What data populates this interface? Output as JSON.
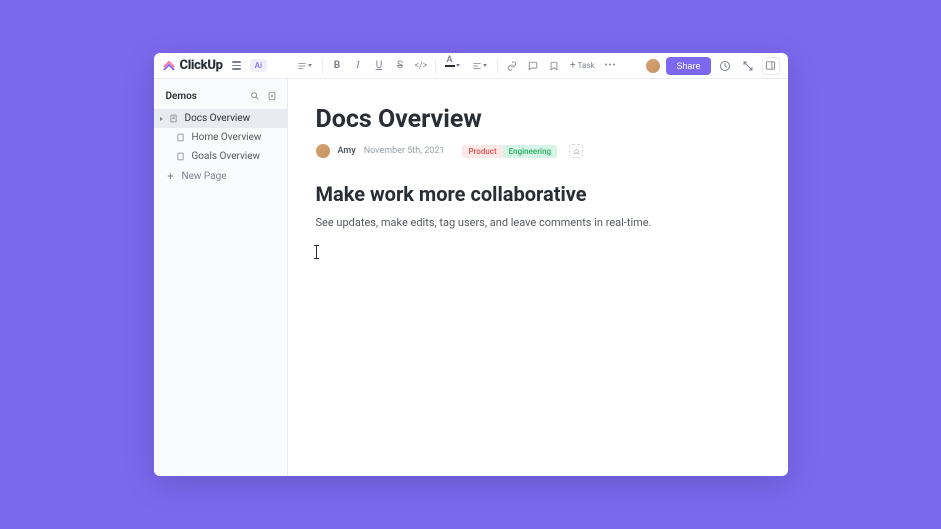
{
  "brand": {
    "name": "ClickUp",
    "ai_badge": "Ai"
  },
  "topbar": {
    "task_label": "Task",
    "share_label": "Share"
  },
  "sidebar": {
    "title": "Demos",
    "items": [
      {
        "label": "Docs Overview",
        "active": true,
        "icon": "doc"
      },
      {
        "label": "Home Overview",
        "active": false,
        "icon": "page"
      },
      {
        "label": "Goals Overview",
        "active": false,
        "icon": "page"
      }
    ],
    "new_page_label": "New Page"
  },
  "document": {
    "title": "Docs Overview",
    "author": "Amy",
    "date": "November 5th, 2021",
    "tags": {
      "product": "Product",
      "engineering": "Engineering"
    },
    "heading": "Make work more collaborative",
    "body": "See updates, make edits, tag users, and leave comments in real-time."
  }
}
